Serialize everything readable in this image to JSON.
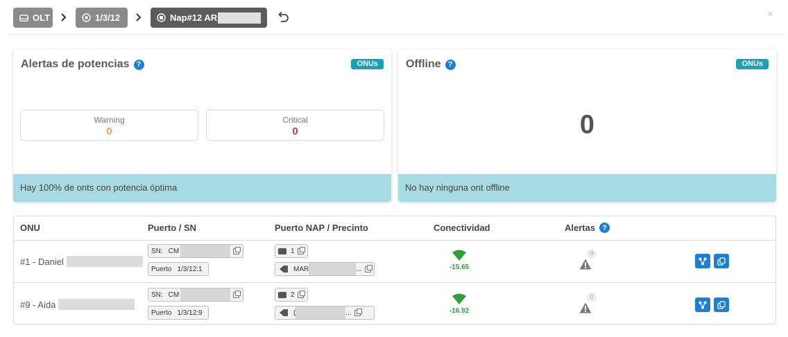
{
  "breadcrumb": {
    "items": [
      {
        "label": "OLT",
        "icon": "server-icon"
      },
      {
        "label": "1/3/12",
        "icon": "target-icon"
      },
      {
        "label": "Nap#12 AR",
        "icon": "nap-box-icon",
        "redacted": true
      }
    ],
    "undo_icon": "undo-icon",
    "close_label": "×"
  },
  "alerts_card": {
    "title": "Alertas de potencias",
    "badge": "ONUs",
    "help": "?",
    "warning_label": "Warning",
    "warning_value": "0",
    "critical_label": "Critical",
    "critical_value": "0",
    "footer": "Hay 100% de onts con potencia óptima"
  },
  "offline_card": {
    "title": "Offline",
    "badge": "ONUs",
    "help": "?",
    "count": "0",
    "footer": "No hay ninguna ont offline"
  },
  "table": {
    "headers": {
      "onu": "ONU",
      "port_sn": "Puerto / SN",
      "nap": "Puerto NAP / Precinto",
      "connectivity": "Conectividad",
      "alerts": "Alertas",
      "help": "?"
    },
    "rows": [
      {
        "onu": "#1 - Daniel",
        "sn_label": "SN:",
        "sn_value": "CM",
        "port_label": "Puerto",
        "port_value": "1/3/12:1",
        "nap_port": "1",
        "seal": "MAR",
        "seal_suffix": "...",
        "signal": "-15.65",
        "alert_count": "0"
      },
      {
        "onu": "#9 - Aida",
        "sn_label": "SN:",
        "sn_value": "CM",
        "port_label": "Puerto",
        "port_value": "1/3/12:9",
        "nap_port": "2",
        "seal": "(",
        "seal_suffix": "...",
        "signal": "-16.92",
        "alert_count": "0"
      }
    ]
  },
  "colors": {
    "accent_blue": "#1d7fcf",
    "badge_teal": "#17a2b8",
    "footer_bg": "#a6dbe3",
    "warning": "#f0a33a",
    "critical": "#dd3333",
    "signal_green": "#2f9e3b"
  }
}
